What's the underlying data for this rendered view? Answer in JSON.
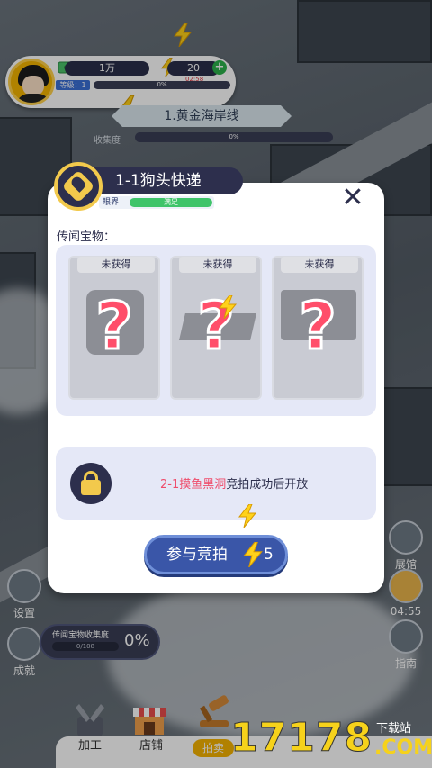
{
  "hud": {
    "money": "1万",
    "energy": "20",
    "energy_timer": "02:58",
    "level_label": "等级：1",
    "level_progress": "0%"
  },
  "area": {
    "name": "1.黄金海岸线",
    "collect_label": "收集度",
    "collect_progress": "0%"
  },
  "modal": {
    "title": "1-1狗头快递",
    "vision_label": "眼界",
    "vision_status": "满足",
    "section_label": "传闻宝物：",
    "treasures": [
      {
        "status": "未获得",
        "mark": "?"
      },
      {
        "status": "未获得",
        "mark": "?"
      },
      {
        "status": "未获得",
        "mark": "?"
      }
    ],
    "unlock_highlight": "2-1摸鱼黑洞",
    "unlock_text": "竞拍成功后开放",
    "bid_label": "参与竞拍",
    "bid_cost": "5",
    "close_icon": "close-icon"
  },
  "side": {
    "settings_label": "设置",
    "achievement_label": "成就",
    "expo_label": "展馆",
    "expo_timer": "04:55",
    "guide_label": "指南"
  },
  "collection_box": {
    "title": "传闻宝物收集度",
    "count": "0/108",
    "percent": "0%"
  },
  "bottom_nav": {
    "process_label": "加工",
    "shop_label": "店铺",
    "auction_label": "拍卖"
  },
  "watermark": {
    "digits": "17178",
    "site": "下载站",
    "domain": ".COM"
  },
  "colors": {
    "accent_navy": "#2d2f4d",
    "accent_gold": "#f2c94c",
    "highlight_red": "#ef4c6b",
    "bid_blue": "#3a56a8"
  }
}
